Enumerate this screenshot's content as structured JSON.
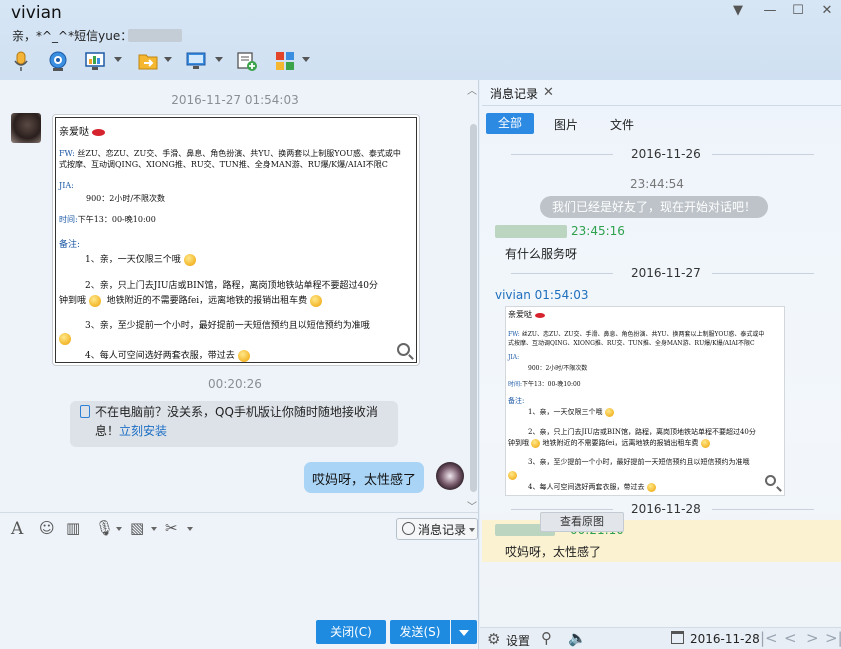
{
  "window": {
    "contact_name": "vivian",
    "signature": "亲，*^_^*短信yue："
  },
  "icons": {
    "minimize": "chevron-down-icon",
    "restore": "restore-icon",
    "maximize": "maximize-icon",
    "close": "close-icon"
  },
  "chat": {
    "timestamp1": "2016-11-27 01:54:03",
    "timestamp2": "00:20:26",
    "tip_text": "不在电脑前？没关系，QQ手机版让你随时随地接收消息！",
    "tip_link": "立刻安装",
    "my_message": "哎妈呀，太性感了"
  },
  "card": {
    "title": "亲爱哒",
    "fw_label": "FW:",
    "fw_line1": "丝ZU、恋ZU、ZU交、手滑、鼻息、角色扮演、共YU、换两套以上制服YOU惑、泰式或中",
    "fw_line2": "式按摩、互动调QING、XIONG推、RU交、TUN推、全身MAN游、RU爆/K爆/AIAI不限C",
    "jia_label": "JIA:",
    "jia_value": "900：2小时/不限次数",
    "time_label": "时间:",
    "time_value": "下午13：00-晚10:00",
    "note_label": "备注:",
    "note1": "1、亲，一天仅限三个哦",
    "note2a": "2、亲，只上门去JIU店或BIN馆，路程，离岗顶地铁站单程不要超过40分",
    "note2b": "钟到哦",
    "note2c": "地铁附近的不需要路fei，远离地铁的报销出租车费",
    "note3": "3、亲，至少提前一个小时，最好提前一天短信预约且以短信预约为准哦",
    "note4": "4、每人可空间选好两套衣服，带过去"
  },
  "input": {
    "history_button": "消息记录",
    "close_button": "关闭(C)",
    "send_button": "发送(S)"
  },
  "history": {
    "tab_title": "消息记录",
    "filter_all": "全部",
    "filter_images": "图片",
    "filter_files": "文件",
    "date1": "2016-11-26",
    "time1": "23:44:54",
    "friend_notice": "我们已经是好友了，现在开始对话吧！",
    "sender_time1": "23:45:16",
    "message1": "有什么服务呀",
    "date2": "2016-11-27",
    "vivian_header": "vivian  01:54:03",
    "view_original": "查看原图",
    "date3": "2016-11-28",
    "sender_time2": "00:21:10",
    "message2": "哎妈呀，太性感了",
    "settings_label": "设置",
    "date_picker_value": "2016-11-28"
  },
  "colors": {
    "accent": "#1e8be0",
    "my_bubble": "#a9d4f5",
    "sender_green": "#2ea14d",
    "link_blue": "#1d6fc4",
    "highlight": "#fbf2d2"
  }
}
